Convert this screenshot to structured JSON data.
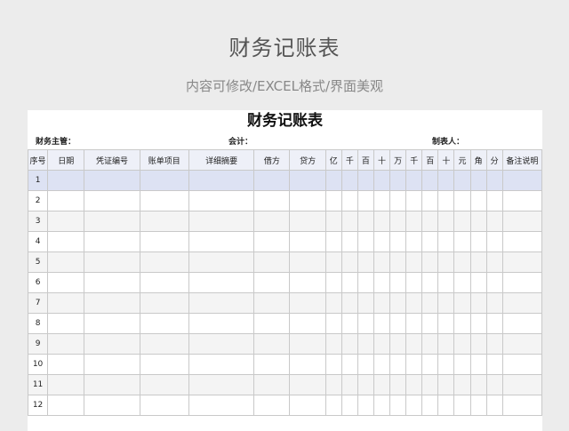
{
  "banner": {
    "title": "财务记账表",
    "subtitle": "内容可修改/EXCEL格式/界面美观"
  },
  "sheet": {
    "title": "财务记账表",
    "meta": {
      "manager_label": "财务主管：",
      "accountant_label": "会计：",
      "preparer_label": "制表人："
    },
    "columns": [
      "序号",
      "日期",
      "凭证编号",
      "账单项目",
      "详细摘要",
      "借方",
      "贷方",
      "亿",
      "千",
      "百",
      "十",
      "万",
      "千",
      "百",
      "十",
      "元",
      "角",
      "分",
      "备注说明"
    ],
    "rows": [
      "1",
      "2",
      "3",
      "4",
      "5",
      "6",
      "7",
      "8",
      "9",
      "10",
      "11",
      "12"
    ]
  },
  "colors": {
    "background": "#ececec",
    "header_bg": "#eef0f8",
    "highlight_row": "#dde2f3",
    "gray_row": "#f4f4f4"
  }
}
